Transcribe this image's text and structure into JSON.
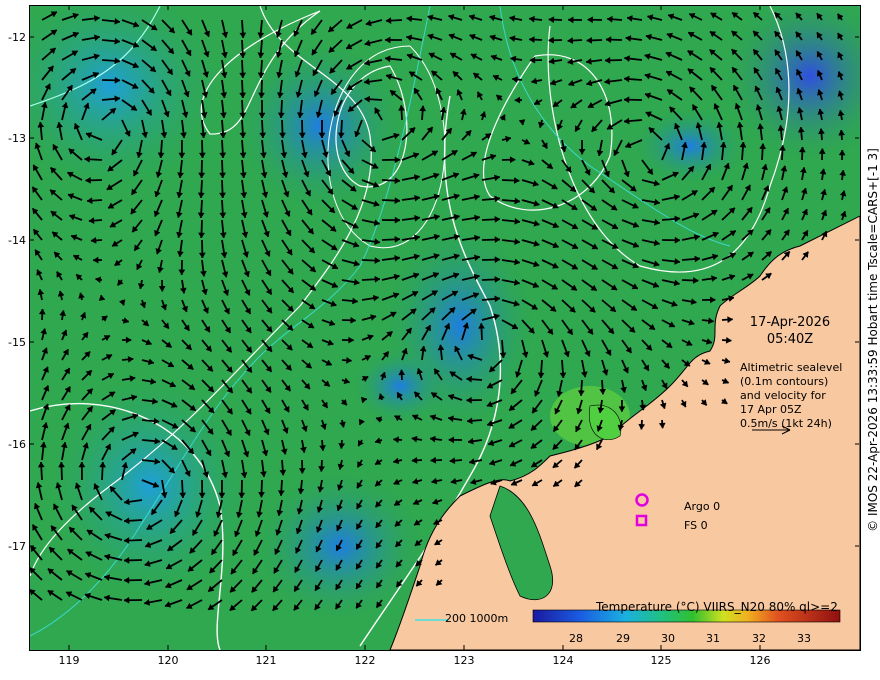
{
  "map": {
    "y_ticks": [
      "-12",
      "-13",
      "-14",
      "-15",
      "-16",
      "-17"
    ],
    "x_ticks": [
      "119",
      "120",
      "121",
      "122",
      "123",
      "124",
      "125",
      "126"
    ],
    "lat_range": [
      -11.7,
      -18.0
    ],
    "lon_range": [
      118.6,
      127.0
    ]
  },
  "date_label": {
    "date": "17-Apr-2026",
    "time": "05:40Z"
  },
  "altimetry_note": {
    "line1": "Altimetric sealevel",
    "line2": "(0.1m contours)",
    "line3": "and velocity for",
    "line4": "17 Apr 05Z",
    "line5": "0.5m/s (1kt 24h)"
  },
  "legend": {
    "argo": "Argo 0",
    "fs": "FS 0",
    "depth_label": "200  1000m",
    "argo_color": "#e000e0",
    "fs_color": "#e000e0"
  },
  "colorbar": {
    "title": "Temperature (°C) VIIRS_N20 80% ql>=2",
    "ticks": [
      "28",
      "29",
      "30",
      "31",
      "32",
      "33"
    ]
  },
  "side_caption": "© IMOS 22-Apr-2026 13:33:59 Hobart time Tscale=CARS+[-1 3]",
  "colors": {
    "land": "#f8c8a0",
    "sea_green": "#2fa84f",
    "contour": "#ffffff",
    "depth_contour": "#40e0e0",
    "arrow": "#000000"
  }
}
